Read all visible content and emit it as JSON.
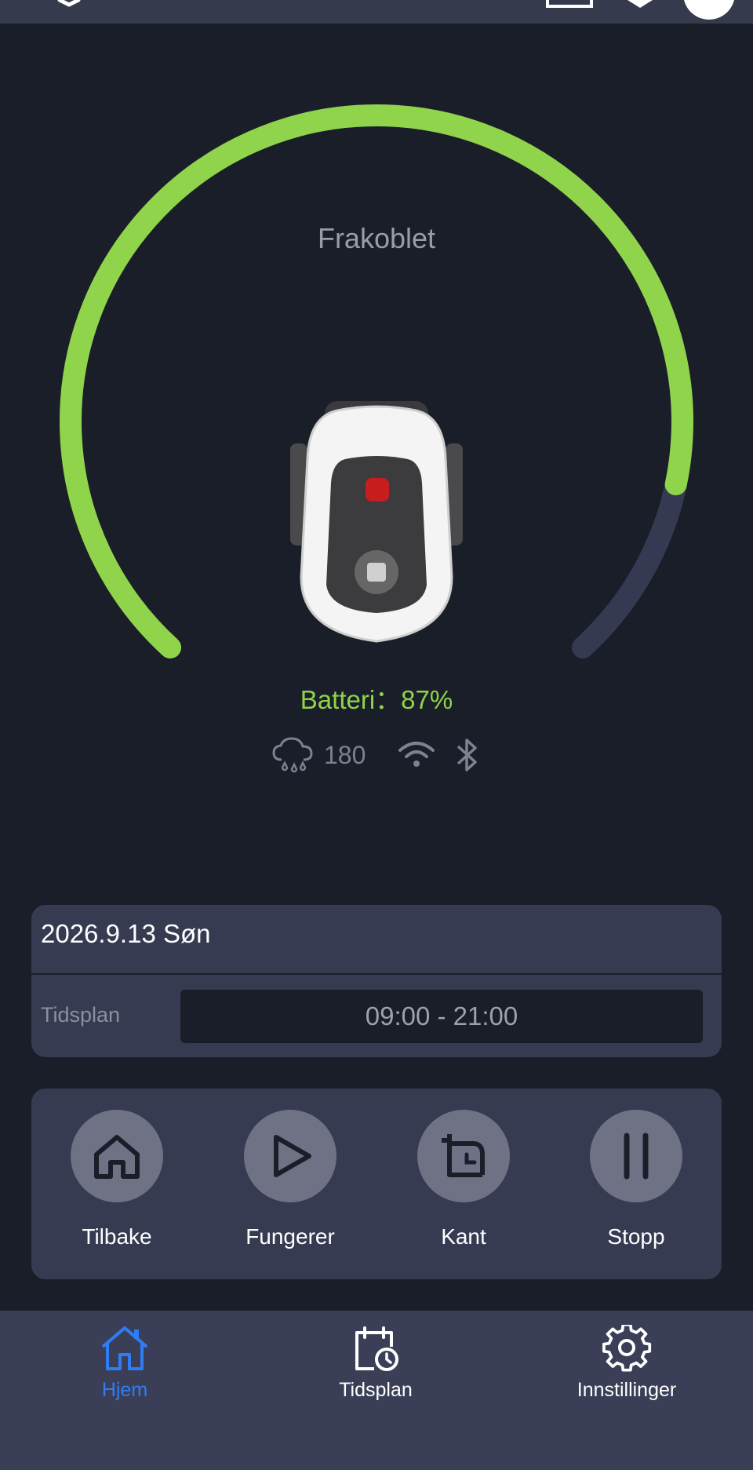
{
  "status": "Frakoblet",
  "battery": {
    "text": "Batteri：87%",
    "percent": 87
  },
  "indicators": {
    "rain_value": "180",
    "icons": [
      "rain-cloud-icon",
      "wifi-icon",
      "bluetooth-icon"
    ]
  },
  "schedule": {
    "date": "2026.9.13 Søn",
    "label": "Tidsplan",
    "time_range": "09:00 - 21:00"
  },
  "controls": [
    {
      "label": "Tilbake",
      "icon": "home-icon"
    },
    {
      "label": "Fungerer",
      "icon": "play-icon"
    },
    {
      "label": "Kant",
      "icon": "edge-icon"
    },
    {
      "label": "Stopp",
      "icon": "pause-icon"
    }
  ],
  "nav": [
    {
      "label": "Hjem",
      "icon": "home-icon",
      "active": true
    },
    {
      "label": "Tidsplan",
      "icon": "calendar-clock-icon",
      "active": false
    },
    {
      "label": "Innstillinger",
      "icon": "gear-icon",
      "active": false
    }
  ],
  "colors": {
    "background": "#1a1e29",
    "card": "#363b52",
    "accent_green": "#8fd44a",
    "gauge_track": "#353a52",
    "nav_active": "#2f7df5"
  }
}
